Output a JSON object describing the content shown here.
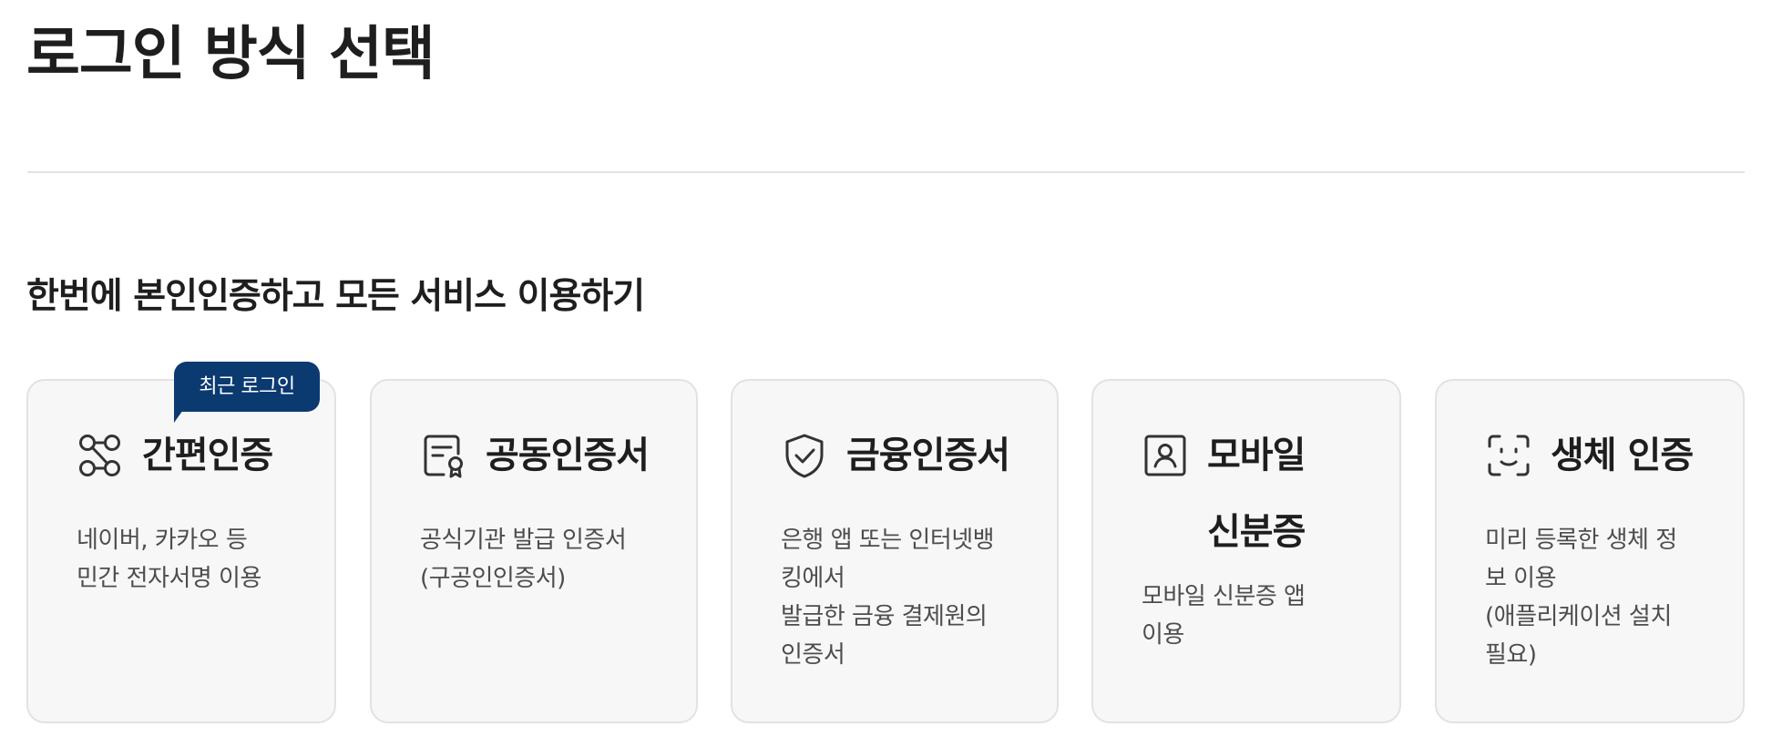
{
  "page": {
    "title": "로그인 방식 선택",
    "section_heading": "한번에 본인인증하고 모든 서비스 이용하기"
  },
  "badge": {
    "label": "최근 로그인"
  },
  "cards": [
    {
      "icon": "simple-auth-link-icon",
      "title": "간편인증",
      "desc": [
        "네이버, 카카오 등",
        "민간 전자서명 이용"
      ]
    },
    {
      "icon": "certificate-document-icon",
      "title": "공동인증서",
      "desc": [
        "공식기관 발급 인증서",
        "(구공인인증서)"
      ]
    },
    {
      "icon": "shield-check-icon",
      "title": "금융인증서",
      "desc": [
        "은행 앱 또는 인터넷뱅",
        "킹에서",
        "발급한 금융 결제원의",
        "인증서"
      ]
    },
    {
      "icon": "id-card-person-icon",
      "title_lines": [
        "모바일",
        "신분증"
      ],
      "desc": [
        "모바일 신분증 앱",
        "이용"
      ]
    },
    {
      "icon": "face-scan-icon",
      "title": "생체 인증",
      "desc": [
        "미리 등록한 생체 정",
        "보 이용",
        "(애플리케이션 설치",
        "필요)"
      ]
    }
  ],
  "colors": {
    "card_background": "#f7f7f7",
    "card_border": "#e2e2e2",
    "badge_background": "#0b3a71",
    "text_primary": "#1e1e1e",
    "text_secondary": "#4d4d4d"
  }
}
